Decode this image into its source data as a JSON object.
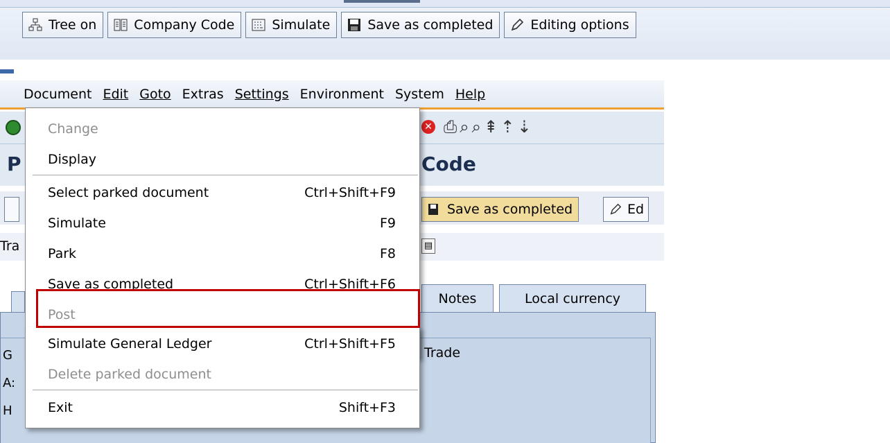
{
  "top_toolbar": {
    "buttons": [
      {
        "label": "Tree on",
        "icon": "tree-icon"
      },
      {
        "label": "Company Code",
        "icon": "company-code-icon"
      },
      {
        "label": "Simulate",
        "icon": "simulate-icon"
      },
      {
        "label": "Save as completed",
        "icon": "save-icon"
      },
      {
        "label": "Editing options",
        "icon": "pencil-icon"
      }
    ]
  },
  "menubar": {
    "items": [
      "Document",
      "Edit",
      "Goto",
      "Extras",
      "Settings",
      "Environment",
      "System",
      "Help"
    ]
  },
  "title_partial": "Code",
  "title_left": "P",
  "app_toolbar": {
    "save_label": "Save as completed",
    "edit_partial": "Ed"
  },
  "field_label_partial": "Tra",
  "tabs": [
    "Notes",
    "Local currency"
  ],
  "panel": {
    "row_labels": [
      "G",
      "A:",
      "H"
    ],
    "trade_text": "Trade"
  },
  "document_menu": {
    "items": [
      {
        "label": "Change",
        "shortcut": "",
        "enabled": false
      },
      {
        "label": "Display",
        "shortcut": "",
        "enabled": true
      },
      {
        "label": "Select parked document",
        "shortcut": "Ctrl+Shift+F9",
        "enabled": true
      },
      {
        "label": "Simulate",
        "shortcut": "F9",
        "enabled": true
      },
      {
        "label": "Park",
        "shortcut": "F8",
        "enabled": true
      },
      {
        "label": "Save as completed",
        "shortcut": "Ctrl+Shift+F6",
        "enabled": true
      },
      {
        "label": "Post",
        "shortcut": "",
        "enabled": false
      },
      {
        "label": "Simulate General Ledger",
        "shortcut": "Ctrl+Shift+F5",
        "enabled": true
      },
      {
        "label": "Delete parked document",
        "shortcut": "",
        "enabled": false
      },
      {
        "label": "Exit",
        "shortcut": "Shift+F3",
        "enabled": true
      }
    ]
  },
  "colors": {
    "highlight": "#c00000",
    "menu_underline": "#f0a030"
  }
}
